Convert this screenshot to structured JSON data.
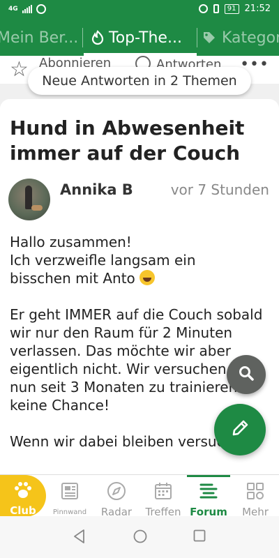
{
  "statusbar": {
    "network": "4G",
    "battery": "91",
    "time": "21:52"
  },
  "tabs": [
    {
      "label": "Mein Ber..."
    },
    {
      "label": "Top-The..."
    },
    {
      "label": "Kategor"
    }
  ],
  "actions": {
    "subscribe": "Abonnieren",
    "reply": "Antworten",
    "more": "•••"
  },
  "banner": {
    "text": "Neue Antworten in 2 Themen"
  },
  "post": {
    "title": "Hund in Abwesenheit immer auf der Couch",
    "author": "Annika B",
    "time": "vor 7 Stunden",
    "para1_l1": "Hallo zusammen!",
    "para1_l2": "Ich verzweifle langsam ein",
    "para1_l3": "bisschen mit Anto",
    "para2": "Er geht IMMER auf die Couch sobald wir nur den Raum für 2 Minuten verlassen. Das möchte wir aber eigentlich nicht. Wir versuchen das nun seit 3 Monaten zu trainieren - keine Chance!",
    "para3": "Wenn wir dabei bleiben versucht"
  },
  "nav": {
    "club": "Club",
    "pinnwand": "Pinnwand",
    "radar": "Radar",
    "treffen": "Treffen",
    "forum": "Forum",
    "mehr": "Mehr"
  },
  "colors": {
    "primary": "#1e8a44",
    "club": "#f5c41a",
    "fab_search": "#5f625f"
  },
  "icons": {
    "tab1": "person-icon",
    "tab2": "flame-icon",
    "tab3": "tag-icon",
    "fab1": "search-icon",
    "fab2": "pencil-icon"
  }
}
